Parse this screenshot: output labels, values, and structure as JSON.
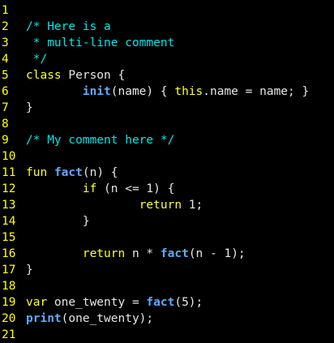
{
  "editor": {
    "colors": {
      "background": "#000000",
      "line_number": "#ffff00",
      "comment": "#00e6e6",
      "keyword": "#ffff33",
      "function": "#5fa9ff",
      "plain": "#e6e6e6"
    },
    "lines": [
      {
        "number": "1",
        "tokens": []
      },
      {
        "number": "2",
        "tokens": [
          {
            "t": "comment",
            "v": "/* Here is a"
          }
        ]
      },
      {
        "number": "3",
        "tokens": [
          {
            "t": "comment",
            "v": " * multi-line comment"
          }
        ]
      },
      {
        "number": "4",
        "tokens": [
          {
            "t": "comment",
            "v": " */"
          }
        ]
      },
      {
        "number": "5",
        "tokens": [
          {
            "t": "keyword",
            "v": "class"
          },
          {
            "t": "plain",
            "v": " Person {"
          }
        ]
      },
      {
        "number": "6",
        "tokens": [
          {
            "t": "plain",
            "v": "        "
          },
          {
            "t": "func",
            "v": "init"
          },
          {
            "t": "plain",
            "v": "(name) { "
          },
          {
            "t": "keyword",
            "v": "this"
          },
          {
            "t": "plain",
            "v": ".name = name; }"
          }
        ]
      },
      {
        "number": "7",
        "tokens": [
          {
            "t": "plain",
            "v": "}"
          }
        ]
      },
      {
        "number": "8",
        "tokens": []
      },
      {
        "number": "9",
        "tokens": [
          {
            "t": "comment",
            "v": "/* My comment here */"
          }
        ]
      },
      {
        "number": "10",
        "tokens": []
      },
      {
        "number": "11",
        "tokens": [
          {
            "t": "keyword",
            "v": "fun"
          },
          {
            "t": "plain",
            "v": " "
          },
          {
            "t": "func",
            "v": "fact"
          },
          {
            "t": "plain",
            "v": "(n) {"
          }
        ]
      },
      {
        "number": "12",
        "tokens": [
          {
            "t": "plain",
            "v": "        "
          },
          {
            "t": "keyword",
            "v": "if"
          },
          {
            "t": "plain",
            "v": " (n <= 1) {"
          }
        ]
      },
      {
        "number": "13",
        "tokens": [
          {
            "t": "plain",
            "v": "                "
          },
          {
            "t": "keyword",
            "v": "return"
          },
          {
            "t": "plain",
            "v": " 1;"
          }
        ]
      },
      {
        "number": "14",
        "tokens": [
          {
            "t": "plain",
            "v": "        }"
          }
        ]
      },
      {
        "number": "15",
        "tokens": []
      },
      {
        "number": "16",
        "tokens": [
          {
            "t": "plain",
            "v": "        "
          },
          {
            "t": "keyword",
            "v": "return"
          },
          {
            "t": "plain",
            "v": " n * "
          },
          {
            "t": "func",
            "v": "fact"
          },
          {
            "t": "plain",
            "v": "(n - 1);"
          }
        ]
      },
      {
        "number": "17",
        "tokens": [
          {
            "t": "plain",
            "v": "}"
          }
        ]
      },
      {
        "number": "18",
        "tokens": []
      },
      {
        "number": "19",
        "tokens": [
          {
            "t": "keyword",
            "v": "var"
          },
          {
            "t": "plain",
            "v": " one_twenty = "
          },
          {
            "t": "func",
            "v": "fact"
          },
          {
            "t": "plain",
            "v": "(5);"
          }
        ]
      },
      {
        "number": "20",
        "tokens": [
          {
            "t": "func",
            "v": "print"
          },
          {
            "t": "plain",
            "v": "(one_twenty);"
          }
        ]
      },
      {
        "number": "21",
        "tokens": []
      }
    ]
  }
}
